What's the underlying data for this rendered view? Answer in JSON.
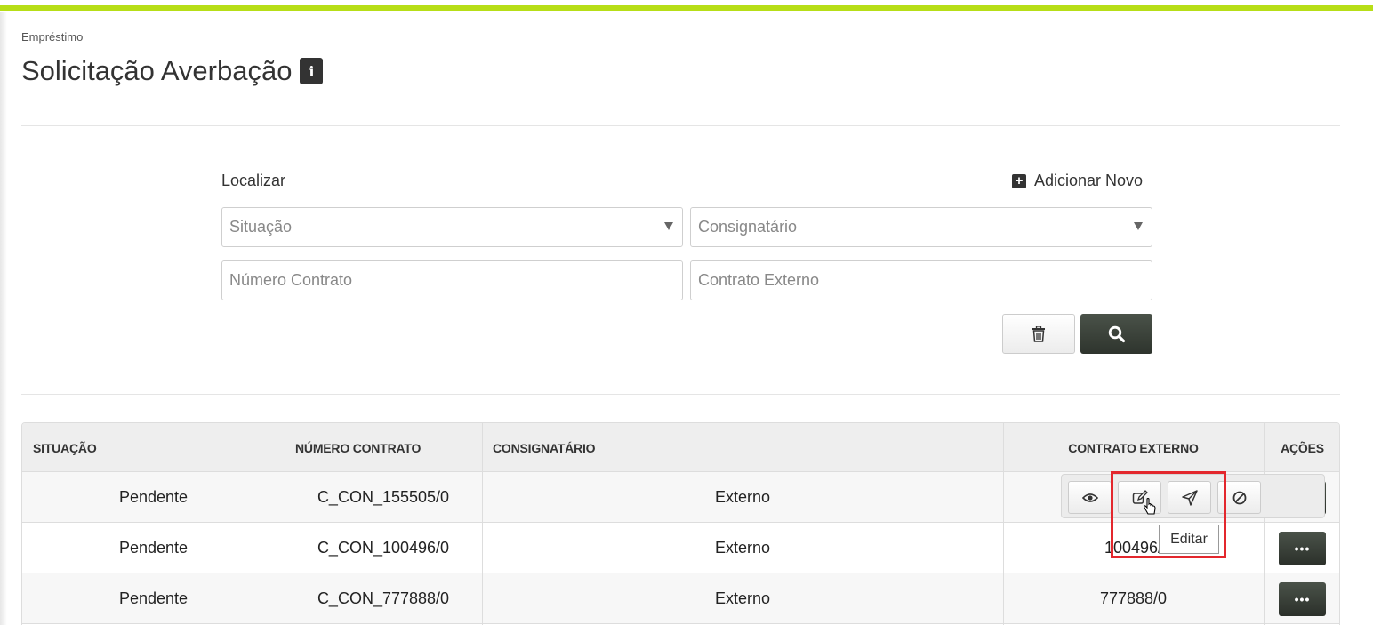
{
  "breadcrumb": "Empréstimo",
  "page_title": "Solicitação Averbação",
  "filters": {
    "label": "Localizar",
    "add_new_label": "Adicionar Novo",
    "situacao_placeholder": "Situação",
    "consignatario_placeholder": "Consignatário",
    "numero_contrato_placeholder": "Número Contrato",
    "contrato_externo_placeholder": "Contrato Externo"
  },
  "table": {
    "headers": {
      "situacao": "SITUAÇÃO",
      "numero_contrato": "NÚMERO CONTRATO",
      "consignatario": "CONSIGNATÁRIO",
      "contrato_externo": "CONTRATO EXTERNO",
      "acoes": "AÇÕES"
    },
    "rows": [
      {
        "situacao": "Pendente",
        "numero_contrato": "C_CON_155505/0",
        "consignatario": "Externo",
        "contrato_externo": ""
      },
      {
        "situacao": "Pendente",
        "numero_contrato": "C_CON_100496/0",
        "consignatario": "Externo",
        "contrato_externo": "100496/"
      },
      {
        "situacao": "Pendente",
        "numero_contrato": "C_CON_777888/0",
        "consignatario": "Externo",
        "contrato_externo": "777888/0"
      }
    ],
    "more_label": "•••"
  },
  "tooltip": "Editar",
  "colors": {
    "accent": "#b7de17",
    "dark_button": "#3a4139",
    "highlight": "#e3272d"
  }
}
